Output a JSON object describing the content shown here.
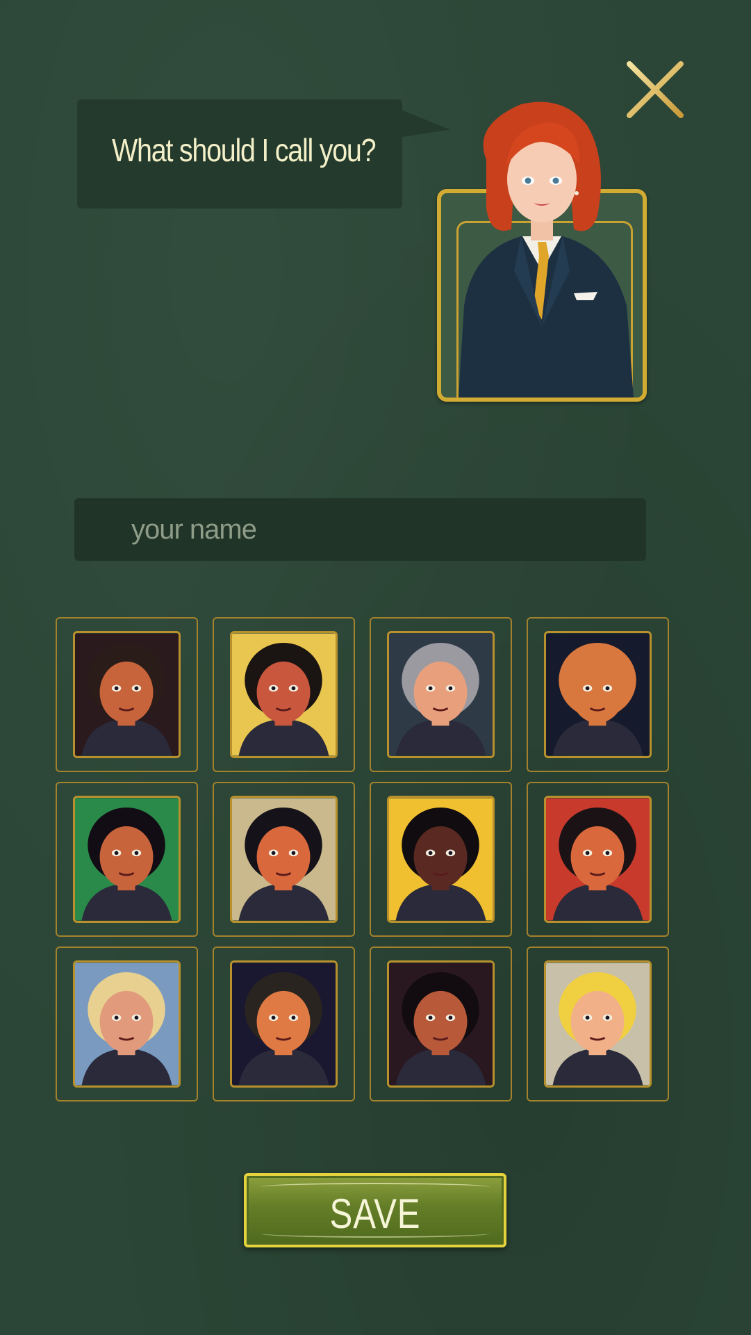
{
  "dialog": {
    "prompt": "What should I call you?",
    "close_icon": "close-icon",
    "host_avatar": "host-portrait"
  },
  "name_field": {
    "placeholder": "your name",
    "value": ""
  },
  "avatars": [
    {
      "id": "avatar-1",
      "bg": "#2a1a1e",
      "skin": "#c8643c",
      "hair": "#2a1c18"
    },
    {
      "id": "avatar-2",
      "bg": "#e9c64f",
      "skin": "#c8573e",
      "hair": "#1a1412"
    },
    {
      "id": "avatar-3",
      "bg": "#2e3a46",
      "skin": "#e8a07c",
      "hair": "#9a9aa0"
    },
    {
      "id": "avatar-4",
      "bg": "#151a2c",
      "skin": "#d9783e",
      "hair": "#d9783e"
    },
    {
      "id": "avatar-5",
      "bg": "#2a8a4a",
      "skin": "#c8643c",
      "hair": "#120c14"
    },
    {
      "id": "avatar-6",
      "bg": "#c9b98c",
      "skin": "#d9683c",
      "hair": "#16121a"
    },
    {
      "id": "avatar-7",
      "bg": "#f0c030",
      "skin": "#5a2a22",
      "hair": "#100c10"
    },
    {
      "id": "avatar-8",
      "bg": "#c83a2c",
      "skin": "#d9683c",
      "hair": "#1a1214"
    },
    {
      "id": "avatar-9",
      "bg": "#7a9ac0",
      "skin": "#e29a7c",
      "hair": "#e8d090"
    },
    {
      "id": "avatar-10",
      "bg": "#1a1830",
      "skin": "#e07a44",
      "hair": "#2a2420"
    },
    {
      "id": "avatar-11",
      "bg": "#2a1820",
      "skin": "#b85a3a",
      "hair": "#120c10"
    },
    {
      "id": "avatar-12",
      "bg": "#c8c0a8",
      "skin": "#f2b088",
      "hair": "#f0d040"
    }
  ],
  "save_button": {
    "label": "SAVE"
  },
  "colors": {
    "background": "#2b4636",
    "gold_border": "#d2ab33",
    "save_green": "#637d27"
  }
}
